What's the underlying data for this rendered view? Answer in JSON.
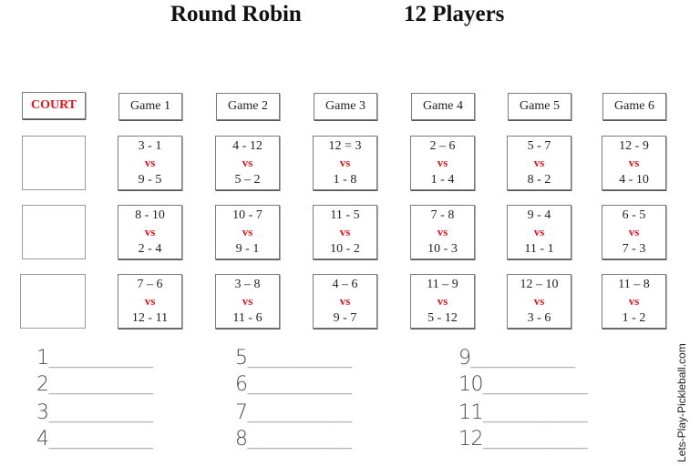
{
  "header": {
    "title": "Round Robin",
    "subtitle": "12 Players"
  },
  "schedule": {
    "court_label": "COURT",
    "games": [
      {
        "label": "Game 1",
        "matches": [
          {
            "team1": "3 - 1",
            "vs": "vs",
            "team2": "9 - 5"
          },
          {
            "team1": "8 - 10",
            "vs": "vs",
            "team2": "2 - 4"
          },
          {
            "team1": "7 – 6",
            "vs": "vs",
            "team2": "12 - 11"
          }
        ]
      },
      {
        "label": "Game 2",
        "matches": [
          {
            "team1": "4 - 12",
            "vs": "vs",
            "team2": "5 – 2"
          },
          {
            "team1": "10 - 7",
            "vs": "vs",
            "team2": "9 - 1"
          },
          {
            "team1": "3 – 8",
            "vs": "vs",
            "team2": "11 - 6"
          }
        ]
      },
      {
        "label": "Game 3",
        "matches": [
          {
            "team1": "12 = 3",
            "vs": "vs",
            "team2": "1 - 8"
          },
          {
            "team1": "11 - 5",
            "vs": "vs",
            "team2": "10 - 2"
          },
          {
            "team1": "4 – 6",
            "vs": "vs",
            "team2": "9 - 7"
          }
        ]
      },
      {
        "label": "Game 4",
        "matches": [
          {
            "team1": "2 – 6",
            "vs": "vs",
            "team2": "1 - 4"
          },
          {
            "team1": "7 - 8",
            "vs": "vs",
            "team2": "10 - 3"
          },
          {
            "team1": "11 – 9",
            "vs": "vs",
            "team2": "5 - 12"
          }
        ]
      },
      {
        "label": "Game 5",
        "matches": [
          {
            "team1": "5 - 7",
            "vs": "vs",
            "team2": "8 - 2"
          },
          {
            "team1": "9 - 4",
            "vs": "vs",
            "team2": "11 - 1"
          },
          {
            "team1": "12 – 10",
            "vs": "vs",
            "team2": "3 - 6"
          }
        ]
      },
      {
        "label": "Game 6",
        "matches": [
          {
            "team1": "12 - 9",
            "vs": "vs",
            "team2": "4 - 10"
          },
          {
            "team1": "6 - 5",
            "vs": "vs",
            "team2": "7 - 3"
          },
          {
            "team1": "11 – 8",
            "vs": "vs",
            "team2": "1 - 2"
          }
        ]
      }
    ],
    "courts": [
      "",
      "",
      ""
    ]
  },
  "players": [
    {
      "number": "1",
      "name": ""
    },
    {
      "number": "2",
      "name": ""
    },
    {
      "number": "3",
      "name": ""
    },
    {
      "number": "4",
      "name": ""
    },
    {
      "number": "5",
      "name": ""
    },
    {
      "number": "6",
      "name": ""
    },
    {
      "number": "7",
      "name": ""
    },
    {
      "number": "8",
      "name": ""
    },
    {
      "number": "9",
      "name": ""
    },
    {
      "number": "10",
      "name": ""
    },
    {
      "number": "11",
      "name": ""
    },
    {
      "number": "12",
      "name": ""
    }
  ],
  "blank_line": "_____________",
  "watermark": "Lets-Play-Pickleball.com",
  "colors": {
    "accent_red": "#e0141b",
    "text": "#222222"
  }
}
